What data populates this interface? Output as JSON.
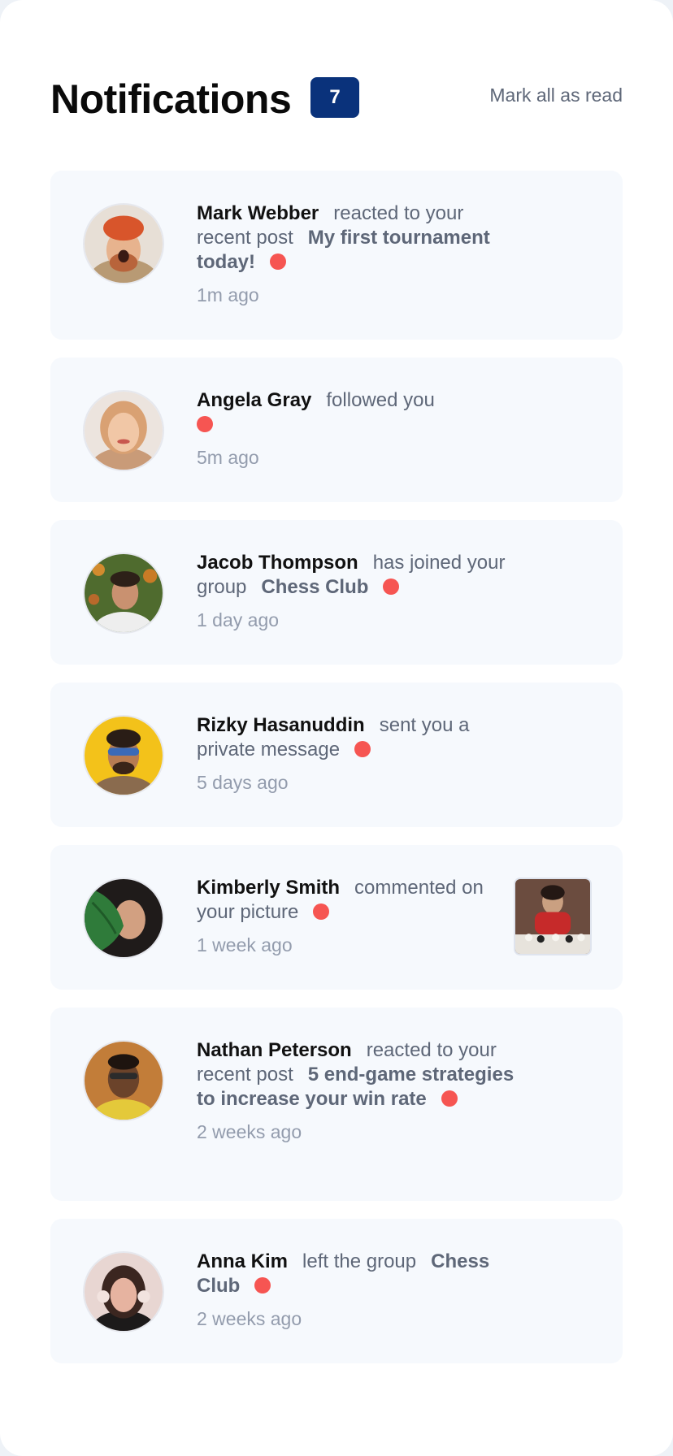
{
  "header": {
    "title": "Notifications",
    "unread_count": "7",
    "mark_all_label": "Mark all as read"
  },
  "notifications": [
    {
      "name": "Mark Webber",
      "action": "reacted to your recent post",
      "target": "My first tournament today!",
      "time": "1m ago",
      "unread": true
    },
    {
      "name": "Angela Gray",
      "action": "followed you",
      "target": "",
      "time": "5m ago",
      "unread": true
    },
    {
      "name": "Jacob Thompson",
      "action": "has joined your group",
      "target": "Chess Club",
      "time": "1 day ago",
      "unread": true
    },
    {
      "name": "Rizky Hasanuddin",
      "action": "sent you a private message",
      "target": "",
      "time": "5 days ago",
      "unread": true
    },
    {
      "name": "Kimberly Smith",
      "action": "commented on your picture",
      "target": "",
      "time": "1 week ago",
      "unread": true
    },
    {
      "name": "Nathan Peterson",
      "action": "reacted to your recent post",
      "target": "5 end-game strategies to increase your win rate",
      "time": "2 weeks ago",
      "unread": true
    },
    {
      "name": "Anna Kim",
      "action": "left the group",
      "target": "Chess Club",
      "time": "2 weeks ago",
      "unread": true
    }
  ],
  "colors": {
    "accent": "#0a327b",
    "unread_dot": "#f65552",
    "card_bg": "#f6f9fd",
    "muted_text": "#5e6778",
    "time_text": "#939cad"
  }
}
